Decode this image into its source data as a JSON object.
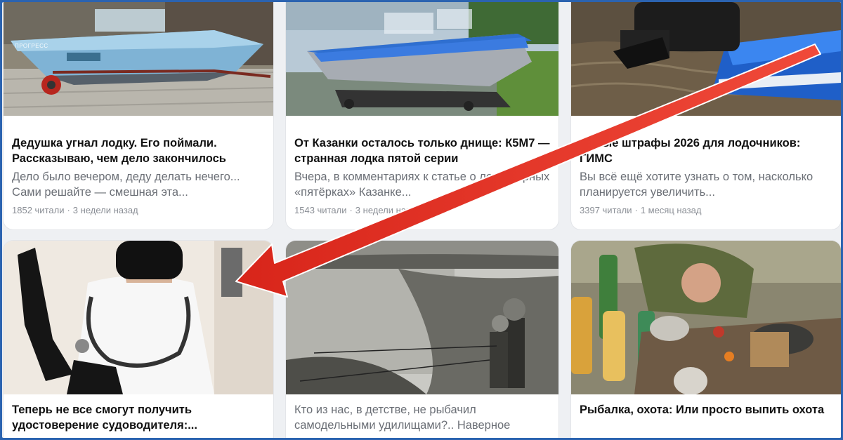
{
  "colors": {
    "border": "#2b63b0",
    "arrow": "#e43a2c",
    "title": "#111111",
    "muted": "#6b6f76"
  },
  "cards": [
    {
      "title": "Дедушка угнал лодку. Его поймали. Рассказываю, чем дело закончилось",
      "snippet": "Дело было вечером, деду делать нечего... Сами решайте — смешная эта...",
      "views": "1852 читали",
      "age": "3 недели назад",
      "image": "boat-on-trailer-photo",
      "image_text": "ПРОГРЕСС"
    },
    {
      "title": "От Казанки осталось только днище: К5М7 — странная лодка пятой серии",
      "snippet": "Вчера, в комментариях к статье о легендарных «пятёрках» Казанке...",
      "views": "1543 читали",
      "age": "3 недели назад",
      "image": "blue-boat-photo"
    },
    {
      "title": "Новые штрафы 2026 для лодочников: ГИМС",
      "snippet": "Вы всё ещё хотите узнать о том, насколько планируется увеличить...",
      "views": "3397 читали",
      "age": "1 месяц назад",
      "image": "outboard-motor-photo"
    },
    {
      "title": "Теперь не все смогут получить удостоверение судоводителя:...",
      "image": "doctor-photo"
    },
    {
      "snippet": "Кто из нас, в детстве, не рыбачил самодельными удилищами?.. Наверное",
      "image": "kids-fishing-photo"
    },
    {
      "title": "Рыбалка, охота: Или просто выпить охота",
      "image": "picnic-photo"
    }
  ]
}
